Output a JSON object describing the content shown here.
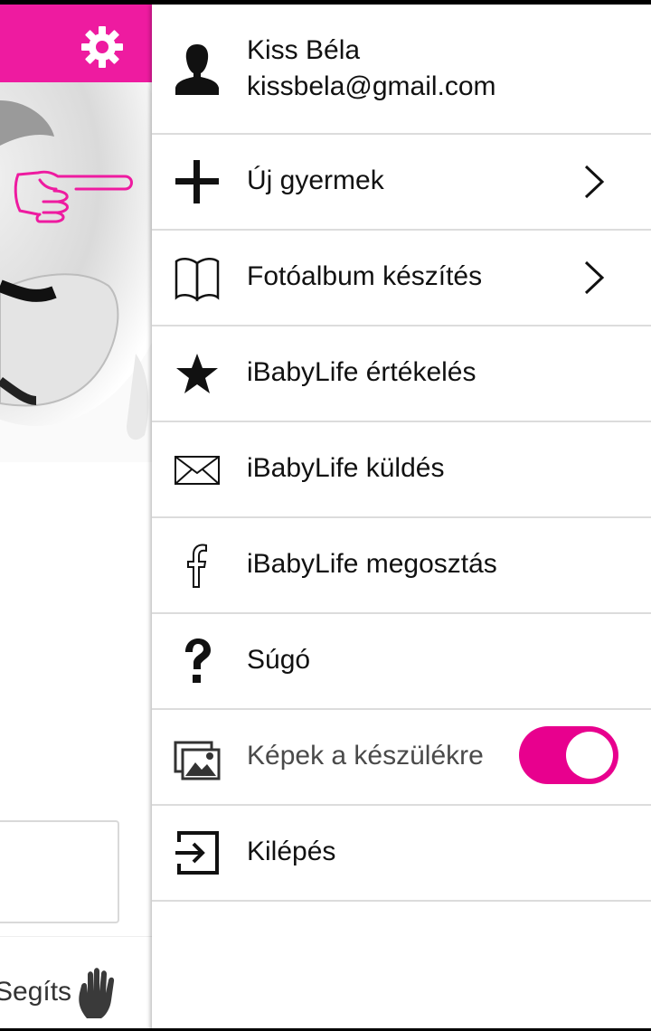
{
  "background": {
    "help_label": "Segíts",
    "accent_color": "#ee1ba0"
  },
  "drawer": {
    "user": {
      "name": "Kiss Béla",
      "email": "kissbela@gmail.com"
    },
    "items": [
      {
        "label": "Új gyermek",
        "icon": "plus-icon",
        "has_chevron": true
      },
      {
        "label": "Fotóalbum készítés",
        "icon": "book-icon",
        "has_chevron": true
      },
      {
        "label": "iBabyLife értékelés",
        "icon": "star-icon",
        "has_chevron": false
      },
      {
        "label": "iBabyLife küldés",
        "icon": "envelope-icon",
        "has_chevron": false
      },
      {
        "label": "iBabyLife megosztás",
        "icon": "facebook-icon",
        "has_chevron": false
      },
      {
        "label": "Súgó",
        "icon": "question-icon",
        "has_chevron": false
      },
      {
        "label": "Képek a készülékre",
        "icon": "images-icon",
        "has_chevron": false,
        "toggle_on": true
      },
      {
        "label": "Kilépés",
        "icon": "logout-icon",
        "has_chevron": false
      }
    ],
    "toggle_color": "#e8008e"
  }
}
